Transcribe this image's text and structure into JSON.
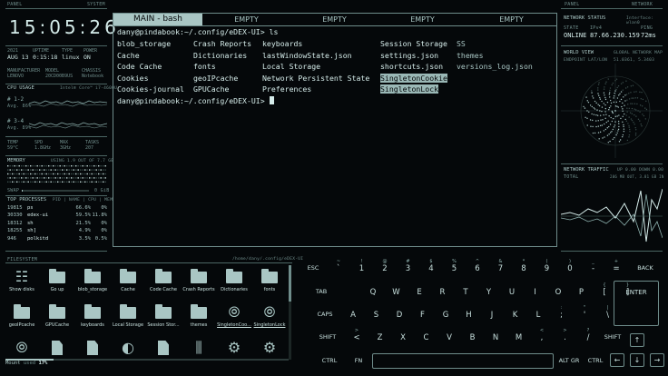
{
  "left_panel": {
    "header_left": "PANEL",
    "header_right": "SYSTEM",
    "clock": "15:05:26",
    "info_top": [
      {
        "label": "2021",
        "value": "AUG 13"
      },
      {
        "label": "UPTIME",
        "value": "0:15:18"
      },
      {
        "label": "TYPE",
        "value": "linux"
      },
      {
        "label": "POWER",
        "value": "ON"
      }
    ],
    "info_hw": [
      {
        "label": "MANUFACTURER",
        "value": "LENOVO"
      },
      {
        "label": "MODEL",
        "value": "20CD00B9US"
      },
      {
        "label": "CHASSIS",
        "value": "Notebook"
      }
    ],
    "cpu": {
      "title": "CPU USAGE",
      "model": "Intel® Core™ i7-4600U",
      "rows": [
        {
          "label": "# 1-2",
          "avg": "Avg. 86%"
        },
        {
          "label": "# 3-4",
          "avg": "Avg. 89%"
        }
      ]
    },
    "stats": [
      {
        "label": "TEMP",
        "value": "59°C"
      },
      {
        "label": "SPD",
        "value": "1.8GHz"
      },
      {
        "label": "MAX",
        "value": "3GHz"
      },
      {
        "label": "TASKS",
        "value": "207"
      }
    ],
    "memory": {
      "title": "MEMORY",
      "usage": "USING 1.9 OUT OF 7.7 GB",
      "swap_label": "SWAP",
      "swap_value": "0 GiB",
      "swap_fraction": 0.02
    },
    "processes": {
      "title": "TOP PROCESSES",
      "columns": "PID | NAME | CPU | MEM",
      "rows": [
        {
          "pid": "19815",
          "name": "ps",
          "cpu": "66.6%",
          "mem": "0%"
        },
        {
          "pid": "30330",
          "name": "edex-ui",
          "cpu": "59.5%",
          "mem": "11.8%"
        },
        {
          "pid": "18312",
          "name": "sh",
          "cpu": "21.5%",
          "mem": "0%"
        },
        {
          "pid": "18255",
          "name": "sh]",
          "cpu": "4.9%",
          "mem": "0%"
        },
        {
          "pid": "946",
          "name": "polkitd",
          "cpu": "3.5%",
          "mem": "0.5%"
        }
      ]
    }
  },
  "terminal": {
    "tabs": [
      "MAIN - bash",
      "EMPTY",
      "EMPTY",
      "EMPTY",
      "EMPTY"
    ],
    "prompt1": "dany@pindabook:~/.config/eDEX-UI> ls",
    "prompt2": "dany@pindabook:~/.config/eDEX-UI> ",
    "columns": [
      [
        "blob_storage",
        "Cache",
        "Code Cache",
        "Cookies",
        "Cookies-journal"
      ],
      [
        "Crash Reports",
        "Dictionaries",
        "fonts",
        "geoIPcache",
        "GPUCache"
      ],
      [
        "keyboards",
        "lastWindowState.json",
        "Local Storage",
        "Network Persistent State",
        "Preferences"
      ],
      [
        "Session Storage",
        "settings.json",
        "shortcuts.json",
        "SingletonCookie",
        "SingletonLock"
      ],
      [
        "SS",
        "themes",
        "versions_log.json"
      ]
    ]
  },
  "filesystem": {
    "title": "FILESYSTEM",
    "path": "/home/dany/.config/eDEX-UI",
    "items": [
      {
        "label": "Show disks",
        "icon": "grid-icon"
      },
      {
        "label": "Go up",
        "icon": "folder-up-icon"
      },
      {
        "label": "blob_storage",
        "icon": "folder-icon"
      },
      {
        "label": "Cache",
        "icon": "folder-icon"
      },
      {
        "label": "Code Cache",
        "icon": "folder-icon"
      },
      {
        "label": "Crash Reports",
        "icon": "folder-icon"
      },
      {
        "label": "Dictionaries",
        "icon": "folder-icon"
      },
      {
        "label": "fonts",
        "icon": "folder-icon"
      },
      {
        "label": "geoIPcache",
        "icon": "folder-icon"
      },
      {
        "label": "GPUCache",
        "icon": "folder-icon"
      },
      {
        "label": "keyboards",
        "icon": "folder-icon"
      },
      {
        "label": "Local Storage",
        "icon": "folder-icon"
      },
      {
        "label": "Session Stor...",
        "icon": "folder-icon"
      },
      {
        "label": "themes",
        "icon": "folder-icon"
      },
      {
        "label": "SingletonCoo...",
        "icon": "link-icon"
      },
      {
        "label": "SingletonLock",
        "icon": "link-icon"
      },
      {
        "label": "",
        "icon": "link-icon"
      },
      {
        "label": "",
        "icon": "file-icon"
      },
      {
        "label": "",
        "icon": "file-icon"
      },
      {
        "label": "",
        "icon": "circle-icon"
      },
      {
        "label": "",
        "icon": "file-icon"
      },
      {
        "label": "",
        "icon": "sliders-icon"
      },
      {
        "label": "",
        "icon": "gear-icon"
      },
      {
        "label": "",
        "icon": "gear-icon"
      }
    ],
    "mount_label": "Mount",
    "used_label": "used",
    "used_value": "17%",
    "used_fraction": 0.17
  },
  "keyboard": {
    "row1": [
      {
        "m": "ESC",
        "s": ""
      },
      {
        "m": "`",
        "s": "~"
      },
      {
        "m": "1",
        "s": "!"
      },
      {
        "m": "2",
        "s": "@"
      },
      {
        "m": "3",
        "s": "#"
      },
      {
        "m": "4",
        "s": "$"
      },
      {
        "m": "5",
        "s": "%"
      },
      {
        "m": "6",
        "s": "^"
      },
      {
        "m": "7",
        "s": "&"
      },
      {
        "m": "8",
        "s": "*"
      },
      {
        "m": "9",
        "s": "("
      },
      {
        "m": "0",
        "s": ")"
      },
      {
        "m": "-",
        "s": "_"
      },
      {
        "m": "=",
        "s": "+"
      },
      {
        "m": "BACK",
        "s": ""
      }
    ],
    "row2": [
      {
        "m": "TAB",
        "s": ""
      },
      {
        "m": "Q",
        "s": ""
      },
      {
        "m": "W",
        "s": ""
      },
      {
        "m": "E",
        "s": ""
      },
      {
        "m": "R",
        "s": ""
      },
      {
        "m": "T",
        "s": ""
      },
      {
        "m": "Y",
        "s": ""
      },
      {
        "m": "U",
        "s": ""
      },
      {
        "m": "I",
        "s": ""
      },
      {
        "m": "O",
        "s": ""
      },
      {
        "m": "P",
        "s": ""
      },
      {
        "m": "[",
        "s": "{"
      },
      {
        "m": "]",
        "s": "}"
      }
    ],
    "enter": "ENTER",
    "row3": [
      {
        "m": "CAPS",
        "s": ""
      },
      {
        "m": "A",
        "s": ""
      },
      {
        "m": "S",
        "s": ""
      },
      {
        "m": "D",
        "s": ""
      },
      {
        "m": "F",
        "s": ""
      },
      {
        "m": "G",
        "s": ""
      },
      {
        "m": "H",
        "s": ""
      },
      {
        "m": "J",
        "s": ""
      },
      {
        "m": "K",
        "s": ""
      },
      {
        "m": "L",
        "s": ""
      },
      {
        "m": ";",
        "s": ":"
      },
      {
        "m": "'",
        "s": "\""
      },
      {
        "m": "\\",
        "s": "|"
      }
    ],
    "row4": [
      {
        "m": "SHIFT",
        "s": ""
      },
      {
        "m": "<",
        "s": ">"
      },
      {
        "m": "Z",
        "s": ""
      },
      {
        "m": "X",
        "s": ""
      },
      {
        "m": "C",
        "s": ""
      },
      {
        "m": "V",
        "s": ""
      },
      {
        "m": "B",
        "s": ""
      },
      {
        "m": "N",
        "s": ""
      },
      {
        "m": "M",
        "s": ""
      },
      {
        "m": ",",
        "s": "<"
      },
      {
        "m": ".",
        "s": ">"
      },
      {
        "m": "/",
        "s": "?"
      },
      {
        "m": "SHIFT",
        "s": ""
      }
    ],
    "row5": [
      {
        "m": "CTRL",
        "s": ""
      },
      {
        "m": "FN",
        "s": ""
      },
      {
        "m": "ALT GR",
        "s": ""
      },
      {
        "m": "CTRL",
        "s": ""
      }
    ],
    "arrows": [
      "↑",
      "←",
      "↓",
      "→"
    ]
  },
  "right_panel": {
    "header_left": "PANEL",
    "header_right": "NETWORK",
    "status_title": "NETWORK STATUS",
    "interface": "Interface: wlan0",
    "state_label": "STATE",
    "state_value": "ONLINE",
    "ip_label": "IPv4",
    "ip_value": "87.66.230.159",
    "ping_label": "PING",
    "ping_value": "72ms",
    "world_title": "WORLD VIEW",
    "world_sub": "GLOBAL NETWORK MAP",
    "endpoint_label": "ENDPOINT LAT/LON",
    "endpoint_value": "51.0361, 5.3403",
    "traffic_title": "NETWORK TRAFFIC",
    "traffic_sub": "UP 0.00 DOWN 0.00",
    "traffic_total": "TOTAL",
    "traffic_total_value": "206 MB OUT, 3.81 GB IN"
  }
}
